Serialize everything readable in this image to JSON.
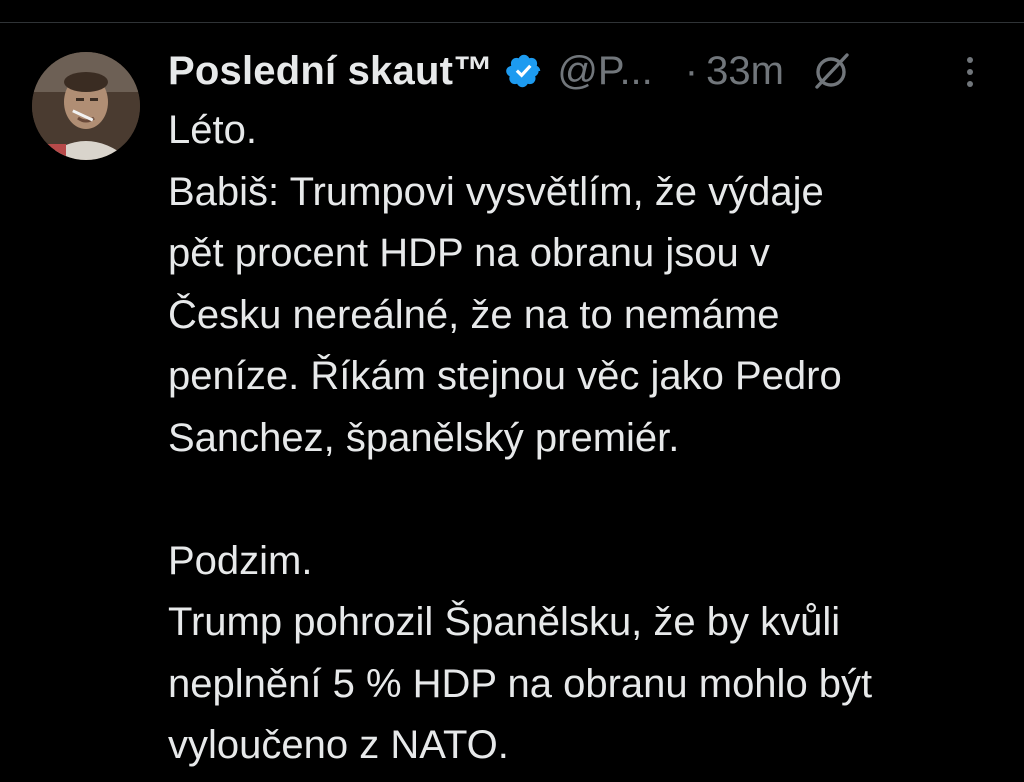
{
  "author": {
    "display_name": "Poslední skaut™",
    "handle": "@P...",
    "verified": true,
    "avatar": "avatar-photo"
  },
  "meta": {
    "separator": "·",
    "time": "33m"
  },
  "icons": {
    "verified": "verified-badge-icon",
    "grok": "grok-icon",
    "more": "more-options-icon"
  },
  "colors": {
    "background": "#000000",
    "text": "#e7e9ea",
    "muted": "#71767b",
    "verified": "#1d9bf0",
    "divider": "#2f3336"
  },
  "tweet": {
    "lines": [
      "Léto.",
      "Babiš: Trumpovi vysvětlím, že výdaje",
      "pět procent HDP na obranu jsou v",
      "Česku nereálné, že na to nemáme",
      "peníze. Říkám stejnou věc jako Pedro",
      "Sanchez, španělský premiér.",
      "",
      "Podzim.",
      "Trump pohrozil Španělsku, že by kvůli",
      "neplnění 5 % HDP na obranu mohlo být",
      "vyloučeno z NATO."
    ]
  }
}
